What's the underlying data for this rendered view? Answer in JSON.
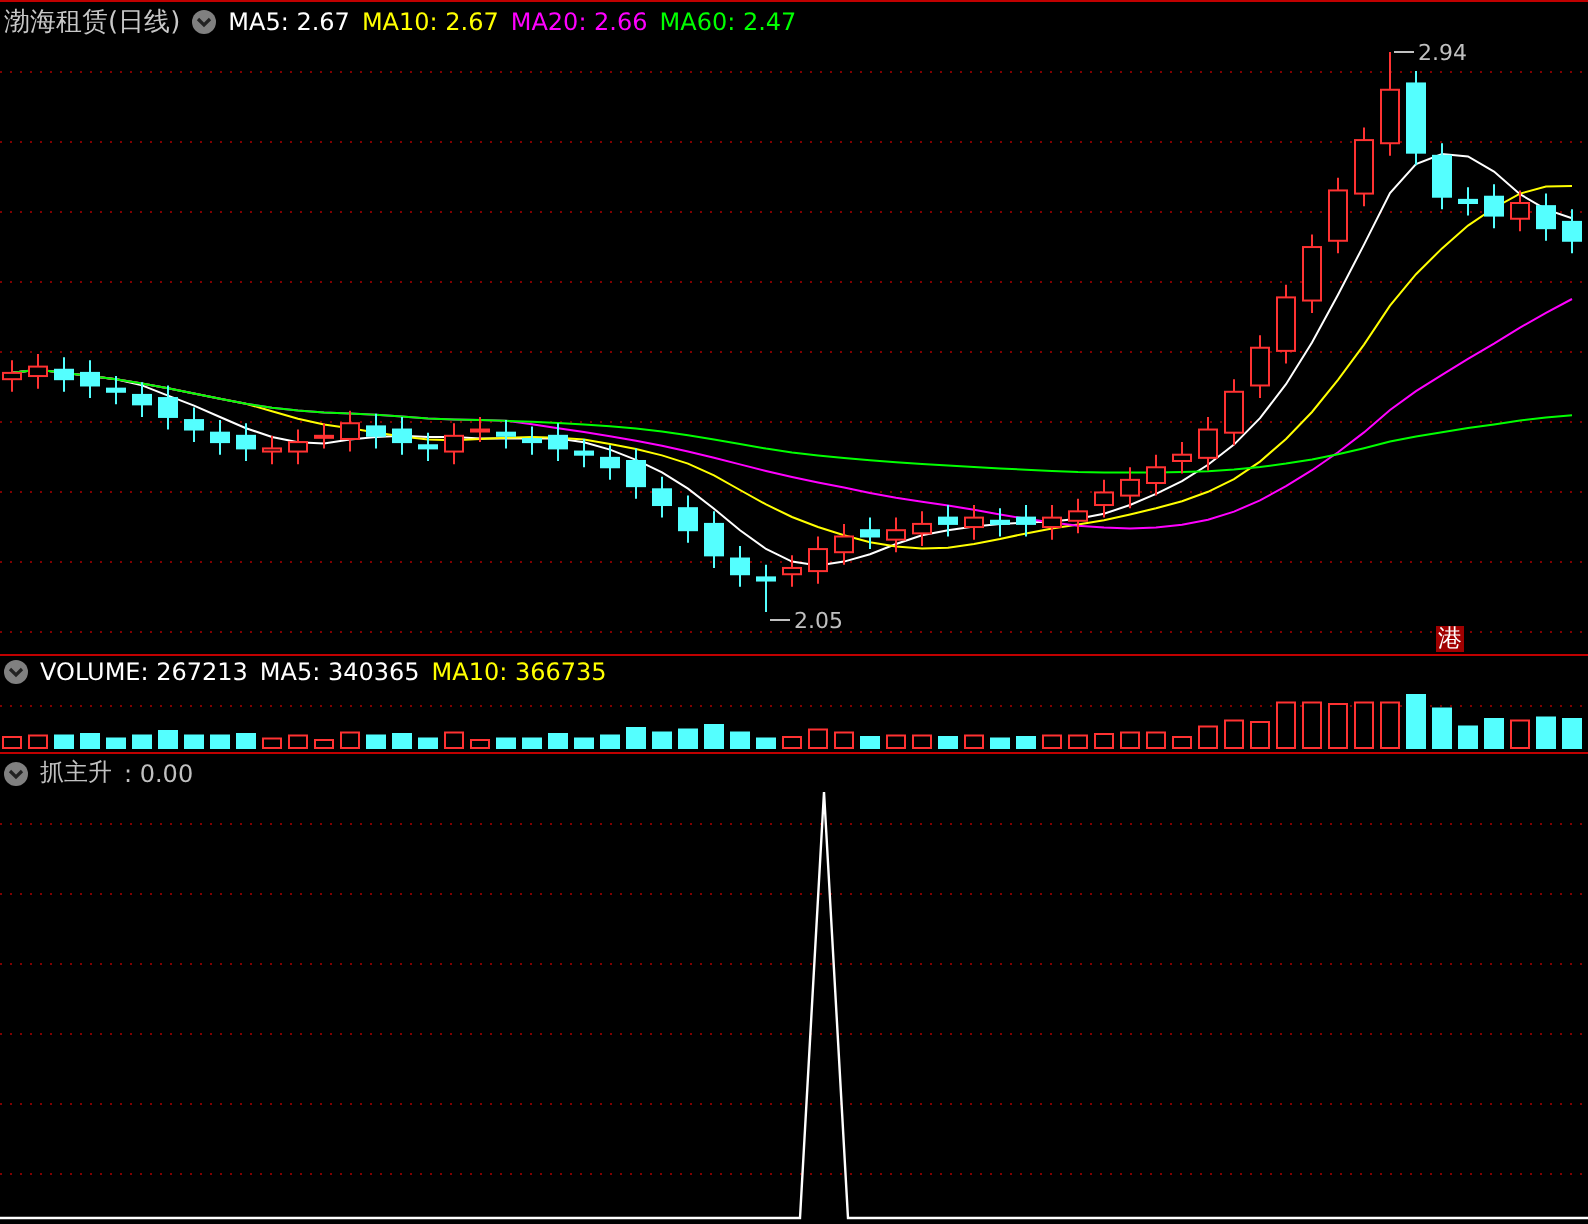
{
  "title": "渤海租赁(日线)",
  "price_legend": [
    {
      "label": "MA5: 2.67",
      "color": "#ffffff"
    },
    {
      "label": "MA10: 2.67",
      "color": "#ffff00"
    },
    {
      "label": "MA20: 2.66",
      "color": "#ff00ff"
    },
    {
      "label": "MA60: 2.47",
      "color": "#00ff00"
    }
  ],
  "high_label": "2.94",
  "low_label": "2.05",
  "market_badge": "港",
  "volume_legend": [
    {
      "label": "VOLUME: 267213",
      "color": "#ffffff"
    },
    {
      "label": "MA5: 340365",
      "color": "#ffffff"
    },
    {
      "label": "MA10: 366735",
      "color": "#ffff00"
    }
  ],
  "indicator": {
    "name": "抓主升",
    "value": ": 0.00"
  }
}
